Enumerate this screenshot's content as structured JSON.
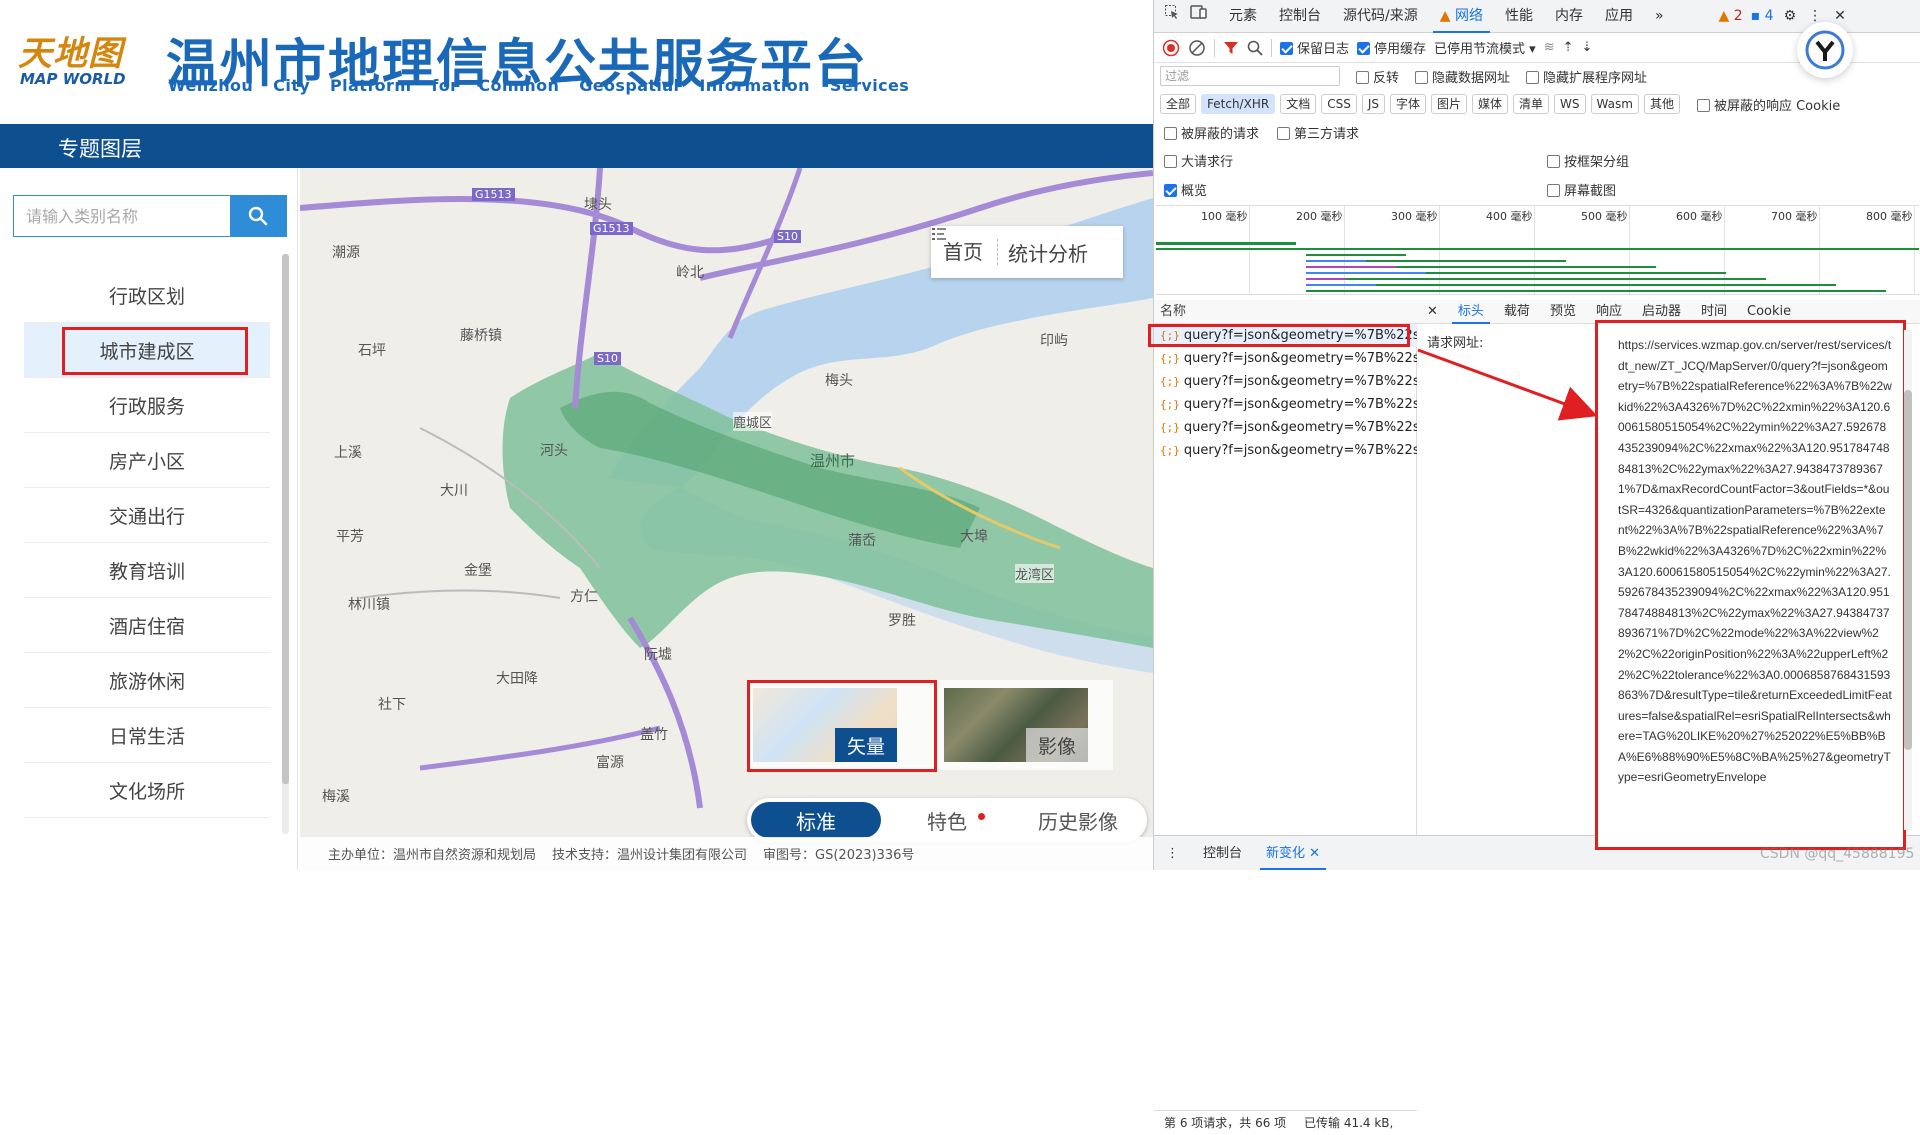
{
  "header": {
    "logo_cn": "天地图",
    "logo_en": "MAP WORLD",
    "title": "温州市地理信息公共服务平台",
    "subtitle": "Wenzhou City Platform for Common Geospatial Information Services"
  },
  "topic_bar": {
    "label": "专题图层"
  },
  "sidebar": {
    "search_placeholder": "请输入类别名称",
    "items": [
      {
        "label": "行政区划"
      },
      {
        "label": "城市建成区"
      },
      {
        "label": "行政服务"
      },
      {
        "label": "房产小区"
      },
      {
        "label": "交通出行"
      },
      {
        "label": "教育培训"
      },
      {
        "label": "酒店住宿"
      },
      {
        "label": "旅游休闲"
      },
      {
        "label": "日常生活"
      },
      {
        "label": "文化场所"
      }
    ]
  },
  "map": {
    "home_label": "首页",
    "stats_label": "统计分析",
    "basemaps": {
      "vector": "矢量",
      "image": "影像"
    },
    "style_options": {
      "standard": "标准",
      "feature": "特色",
      "history": "历史影像"
    },
    "place_labels": {
      "g1513a": "G1513",
      "g1513b": "G1513",
      "s10a": "S10",
      "s10b": "S10",
      "duantou": "埭头",
      "chaoyuan": "潮源",
      "lingbei": "岭北",
      "tengqiao": "藤桥镇",
      "shiping": "石坪",
      "meitou": "梅头",
      "yinxiang": "印屿",
      "luchengqu": "鹿城区",
      "wenzhoushi": "温州市",
      "hexi": "河头",
      "shangxi": "上溪",
      "dachuan": "大川",
      "pingfang": "平芳",
      "jinbao": "金堡",
      "linchuan": "林川镇",
      "fangxian": "方仁",
      "puao": "蒲岙",
      "daxie": "大埠",
      "longwan": "龙湾区",
      "luofeng": "罗胜",
      "ruanzhu": "阮墟",
      "datiantiao": "大田降",
      "shexia": "社下",
      "gaizhu": "盖竹",
      "fuyuan": "富源",
      "meixi": "梅溪"
    }
  },
  "footer": {
    "host": "主办单位：温州市自然资源和规划局",
    "support": "技术支持：温州设计集团有限公司",
    "approval": "审图号：GS(2023)336号"
  },
  "devtools": {
    "tabs": [
      "元素",
      "控制台",
      "源代码/来源",
      "网络",
      "性能",
      "内存",
      "应用"
    ],
    "active_tab": "网络",
    "warn_count": "2",
    "msg_count": "4",
    "toolbar": {
      "preserve_log": "保留日志",
      "disable_cache": "停用缓存",
      "throttle": "已停用节流模式"
    },
    "filter_placeholder": "过滤",
    "filter_opts": [
      "反转",
      "隐藏数据网址",
      "隐藏扩展程序网址"
    ],
    "types": [
      "全部",
      "Fetch/XHR",
      "文档",
      "CSS",
      "JS",
      "字体",
      "图片",
      "媒体",
      "清单",
      "WS",
      "Wasm",
      "其他"
    ],
    "blocked_cookies": "被屏蔽的响应 Cookie",
    "blocked_requests": "被屏蔽的请求",
    "third_party": "第三方请求",
    "large_rows": "大请求行",
    "group_frame": "按框架分组",
    "overview": "概览",
    "screenshots": "屏幕截图",
    "timeline_ticks": [
      "100 毫秒",
      "200 毫秒",
      "300 毫秒",
      "400 毫秒",
      "500 毫秒",
      "600 毫秒",
      "700 毫秒",
      "800 毫秒"
    ],
    "name_header": "名称",
    "requests": [
      "query?f=json&geometry=%7B%22sp...",
      "query?f=json&geometry=%7B%22sp...",
      "query?f=json&geometry=%7B%22sp...",
      "query?f=json&geometry=%7B%22sp...",
      "query?f=json&geometry=%7B%22sp...",
      "query?f=json&geometry=%7B%22sp..."
    ],
    "request_icon": "{;}",
    "status_text": "第 6 项请求，共 66 项",
    "transferred": "已传输 41.4 kB,",
    "detail_tabs": [
      "标头",
      "载荷",
      "预览",
      "响应",
      "启动器",
      "时间",
      "Cookie"
    ],
    "active_detail_tab": "标头",
    "url_label": "请求网址:",
    "url": "https://services.wzmap.gov.cn/server/rest/services/tdt_new/ZT_JCQ/MapServer/0/query?f=json&geometry=%7B%22spatialReference%22%3A%7B%22wkid%22%3A4326%7D%2C%22xmin%22%3A120.60061580515054%2C%22ymin%22%3A27.592678435239094%2C%22xmax%22%3A120.95178474884813%2C%22ymax%22%3A27.94384737893671%7D&maxRecordCountFactor=3&outFields=*&outSR=4326&quantizationParameters=%7B%22extent%22%3A%7B%22spatialReference%22%3A%7B%22wkid%22%3A4326%7D%2C%22xmin%22%3A120.60061580515054%2C%22ymin%22%3A27.592678435239094%2C%22xmax%22%3A120.95178474884813%2C%22ymax%22%3A27.94384737893671%7D%2C%22mode%22%3A%22view%22%2C%22originPosition%22%3A%22upperLeft%22%2C%22tolerance%22%3A0.0006858768431593863%7D&resultType=tile&returnExceededLimitFeatures=false&spatialRel=esriSpatialRelIntersects&where=TAG%20LIKE%20%27%252022%E5%BB%BA%E6%88%90%E5%8C%BA%25%27&geometryType=esriGeometryEnvelope",
    "bottom_tabs": [
      "控制台",
      "新变化"
    ],
    "active_bottom_tab": "新变化"
  },
  "watermark": "CSDN @qq_45888195"
}
